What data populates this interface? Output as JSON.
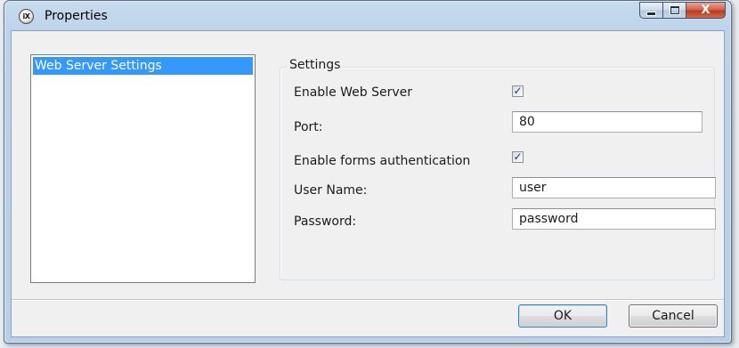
{
  "window": {
    "title": "Properties",
    "app_icon_text": "iX",
    "close_glyph": "X"
  },
  "nav": {
    "items": [
      {
        "label": "Web Server Settings",
        "selected": true
      }
    ]
  },
  "settings": {
    "group_title": "Settings",
    "enable_web_server": {
      "label": "Enable Web Server",
      "checked": true
    },
    "port": {
      "label": "Port:",
      "value": "80"
    },
    "enable_forms_auth": {
      "label": "Enable forms authentication",
      "checked": true
    },
    "user_name": {
      "label": "User Name:",
      "value": "user"
    },
    "password": {
      "label": "Password:",
      "value": "password"
    }
  },
  "footer": {
    "ok_label": "OK",
    "cancel_label": "Cancel"
  },
  "colors": {
    "selection": "#3399ff",
    "window_frame": "#b9d1ea",
    "client_bg": "#f0f0f0"
  }
}
